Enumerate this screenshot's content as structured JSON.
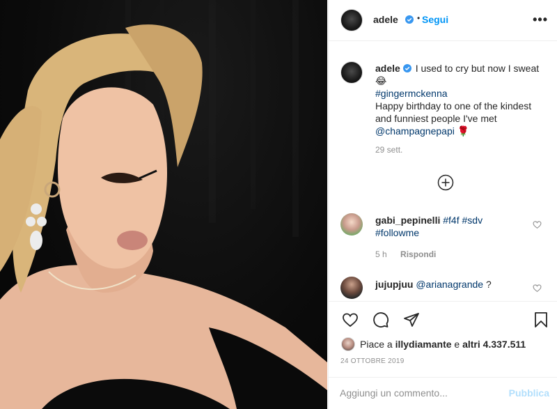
{
  "post": {
    "username": "adele",
    "follow_label": "Segui",
    "more_icon": "more-options-icon",
    "more_label": "•••"
  },
  "caption": {
    "username": "adele",
    "line1": "I used to cry but now I sweat",
    "emoji1": "😂",
    "hashtag": "#gingermckenna",
    "body": "Happy birthday to one of the kindest and funniest people I've met",
    "mention": "@champagnepapi",
    "emoji2": "🌹",
    "time": "29 sett."
  },
  "comments": [
    {
      "username": "gabi_pepinelli",
      "text_tags": "#f4f #sdv",
      "text_tags2": "#followme",
      "time": "5 h",
      "reply_label": "Rispondi"
    },
    {
      "username": "jujupjuu",
      "mention": "@arianagrande",
      "text": "?"
    }
  ],
  "likes": {
    "prefix": "Piace a",
    "user": "illydiamante",
    "mid": "e",
    "others": "altri 4.337.511"
  },
  "date": "24 OTTOBRE 2019",
  "add_comment": {
    "placeholder": "Aggiungi un commento...",
    "publish_label": "Pubblica"
  },
  "colors": {
    "accent": "#0095f6",
    "link": "#00376b",
    "muted": "#8e8e8e",
    "verified": "#3897f0"
  }
}
